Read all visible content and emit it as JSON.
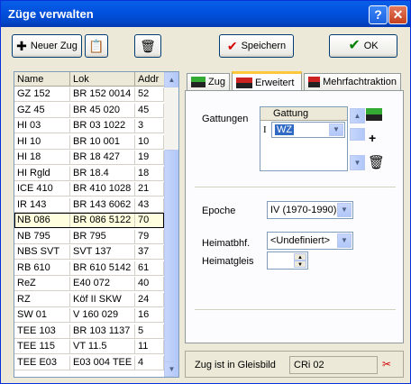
{
  "window": {
    "title": "Züge verwalten"
  },
  "toolbar": {
    "new_train_label": "Neuer Zug",
    "save_label": "Speichern",
    "ok_label": "OK"
  },
  "list": {
    "columns": [
      "Name",
      "Lok",
      "Addr"
    ],
    "rows": [
      {
        "name": "GZ 152",
        "lok": "BR 152 0014",
        "addr": "52"
      },
      {
        "name": "GZ 45",
        "lok": "BR 45 020",
        "addr": "45"
      },
      {
        "name": "HI 03",
        "lok": "BR 03 1022",
        "addr": "3"
      },
      {
        "name": "HI 10",
        "lok": "BR 10 001",
        "addr": "10"
      },
      {
        "name": "HI 18",
        "lok": "BR 18 427",
        "addr": "19"
      },
      {
        "name": "HI Rgld",
        "lok": "BR 18.4",
        "addr": "18"
      },
      {
        "name": "ICE 410",
        "lok": "BR 410 1028",
        "addr": "21"
      },
      {
        "name": "IR 143",
        "lok": "BR 143 6062",
        "addr": "43"
      },
      {
        "name": "NB 086",
        "lok": "BR 086 5122",
        "addr": "70"
      },
      {
        "name": "NB 795",
        "lok": "BR 795",
        "addr": "79"
      },
      {
        "name": "NBS SVT",
        "lok": "SVT 137",
        "addr": "37"
      },
      {
        "name": "RB 610",
        "lok": "BR 610 5142",
        "addr": "61"
      },
      {
        "name": "ReZ",
        "lok": "E40 072",
        "addr": "40"
      },
      {
        "name": "RZ",
        "lok": "Köf II SKW",
        "addr": "24"
      },
      {
        "name": "SW 01",
        "lok": "V 160 029",
        "addr": "16"
      },
      {
        "name": "TEE 103",
        "lok": "BR 103 1137",
        "addr": "5"
      },
      {
        "name": "TEE 115",
        "lok": "VT 11.5",
        "addr": "11"
      },
      {
        "name": "TEE E03",
        "lok": "E03 004 TEE",
        "addr": "4"
      }
    ],
    "selected_index": 8
  },
  "tabs": [
    {
      "label": "Zug"
    },
    {
      "label": "Erweitert"
    },
    {
      "label": "Mehrfachtraktion"
    }
  ],
  "active_tab": 1,
  "panel": {
    "gattungen_label": "Gattungen",
    "grid_header": "Gattung",
    "grid_row_marker": "I",
    "grid_value": "WZ",
    "epoche_label": "Epoche",
    "epoche_value": "IV (1970-1990)",
    "heimatbhf_label": "Heimatbhf.",
    "heimatbhf_value": "<Undefiniert>",
    "heimatgleis_label": "Heimatgleis",
    "heimatgleis_value": ""
  },
  "status": {
    "label": "Zug ist in Gleisbild",
    "value": "CRi 02"
  },
  "colors": {
    "title_bar": "#0a5fe6",
    "selected_row": "#ffffe0",
    "active_tab_accent": "#ffc83c",
    "check_green": "#008000",
    "check_red": "#d40000"
  },
  "icons": [
    "plus-icon",
    "copy-icon",
    "trash-icon",
    "checkmark-icon",
    "help-icon",
    "close-icon",
    "train-icon",
    "row-pointer-icon"
  ]
}
